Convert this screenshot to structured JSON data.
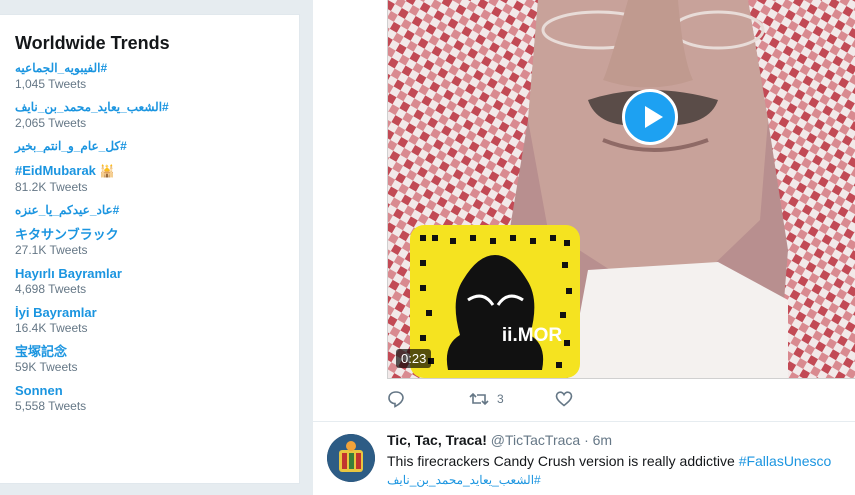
{
  "trends": {
    "title": "Worldwide Trends",
    "items": [
      {
        "name": "#الفيبويه_الجماعيه",
        "count": "1,045 Tweets",
        "rtl": true
      },
      {
        "name": "#الشعب_يعايد_محمد_بن_نايف",
        "count": "2,065 Tweets",
        "rtl": true
      },
      {
        "name": "#كل_عام_و_انتم_بخير",
        "count": "",
        "rtl": true
      },
      {
        "name": "#EidMubarak",
        "count": "81.2K Tweets",
        "emoji": "🕌"
      },
      {
        "name": "#عاد_عيدكم_يا_عنزه",
        "count": "",
        "rtl": true
      },
      {
        "name": "キタサンブラック",
        "count": "27.1K Tweets"
      },
      {
        "name": "Hayırlı Bayramlar",
        "count": "4,698 Tweets"
      },
      {
        "name": "İyi Bayramlar",
        "count": "16.4K Tweets"
      },
      {
        "name": "宝塚記念",
        "count": "59K Tweets"
      },
      {
        "name": "Sonnen",
        "count": "5,558 Tweets"
      }
    ]
  },
  "media": {
    "duration": "0:23",
    "snap_text": "ii.MOR",
    "play_icon": "play-icon"
  },
  "actions": {
    "reply_icon": "reply-icon",
    "retweet_icon": "retweet-icon",
    "retweet_count": "3",
    "like_icon": "heart-icon"
  },
  "tweet2": {
    "name": "Tic, Tac, Traca!",
    "handle": "@TicTacTraca",
    "time": "· 6m",
    "text": "This firecrackers Candy Crush version is really addictive ",
    "hashtag": "#FallasUnesco",
    "hashtag2": "#الشعب_يعايد_محمد_بن_نايف"
  },
  "colors": {
    "link": "#1b95e0",
    "play": "#1da1f2",
    "muted": "#657786",
    "background": "#e6ecf0"
  }
}
